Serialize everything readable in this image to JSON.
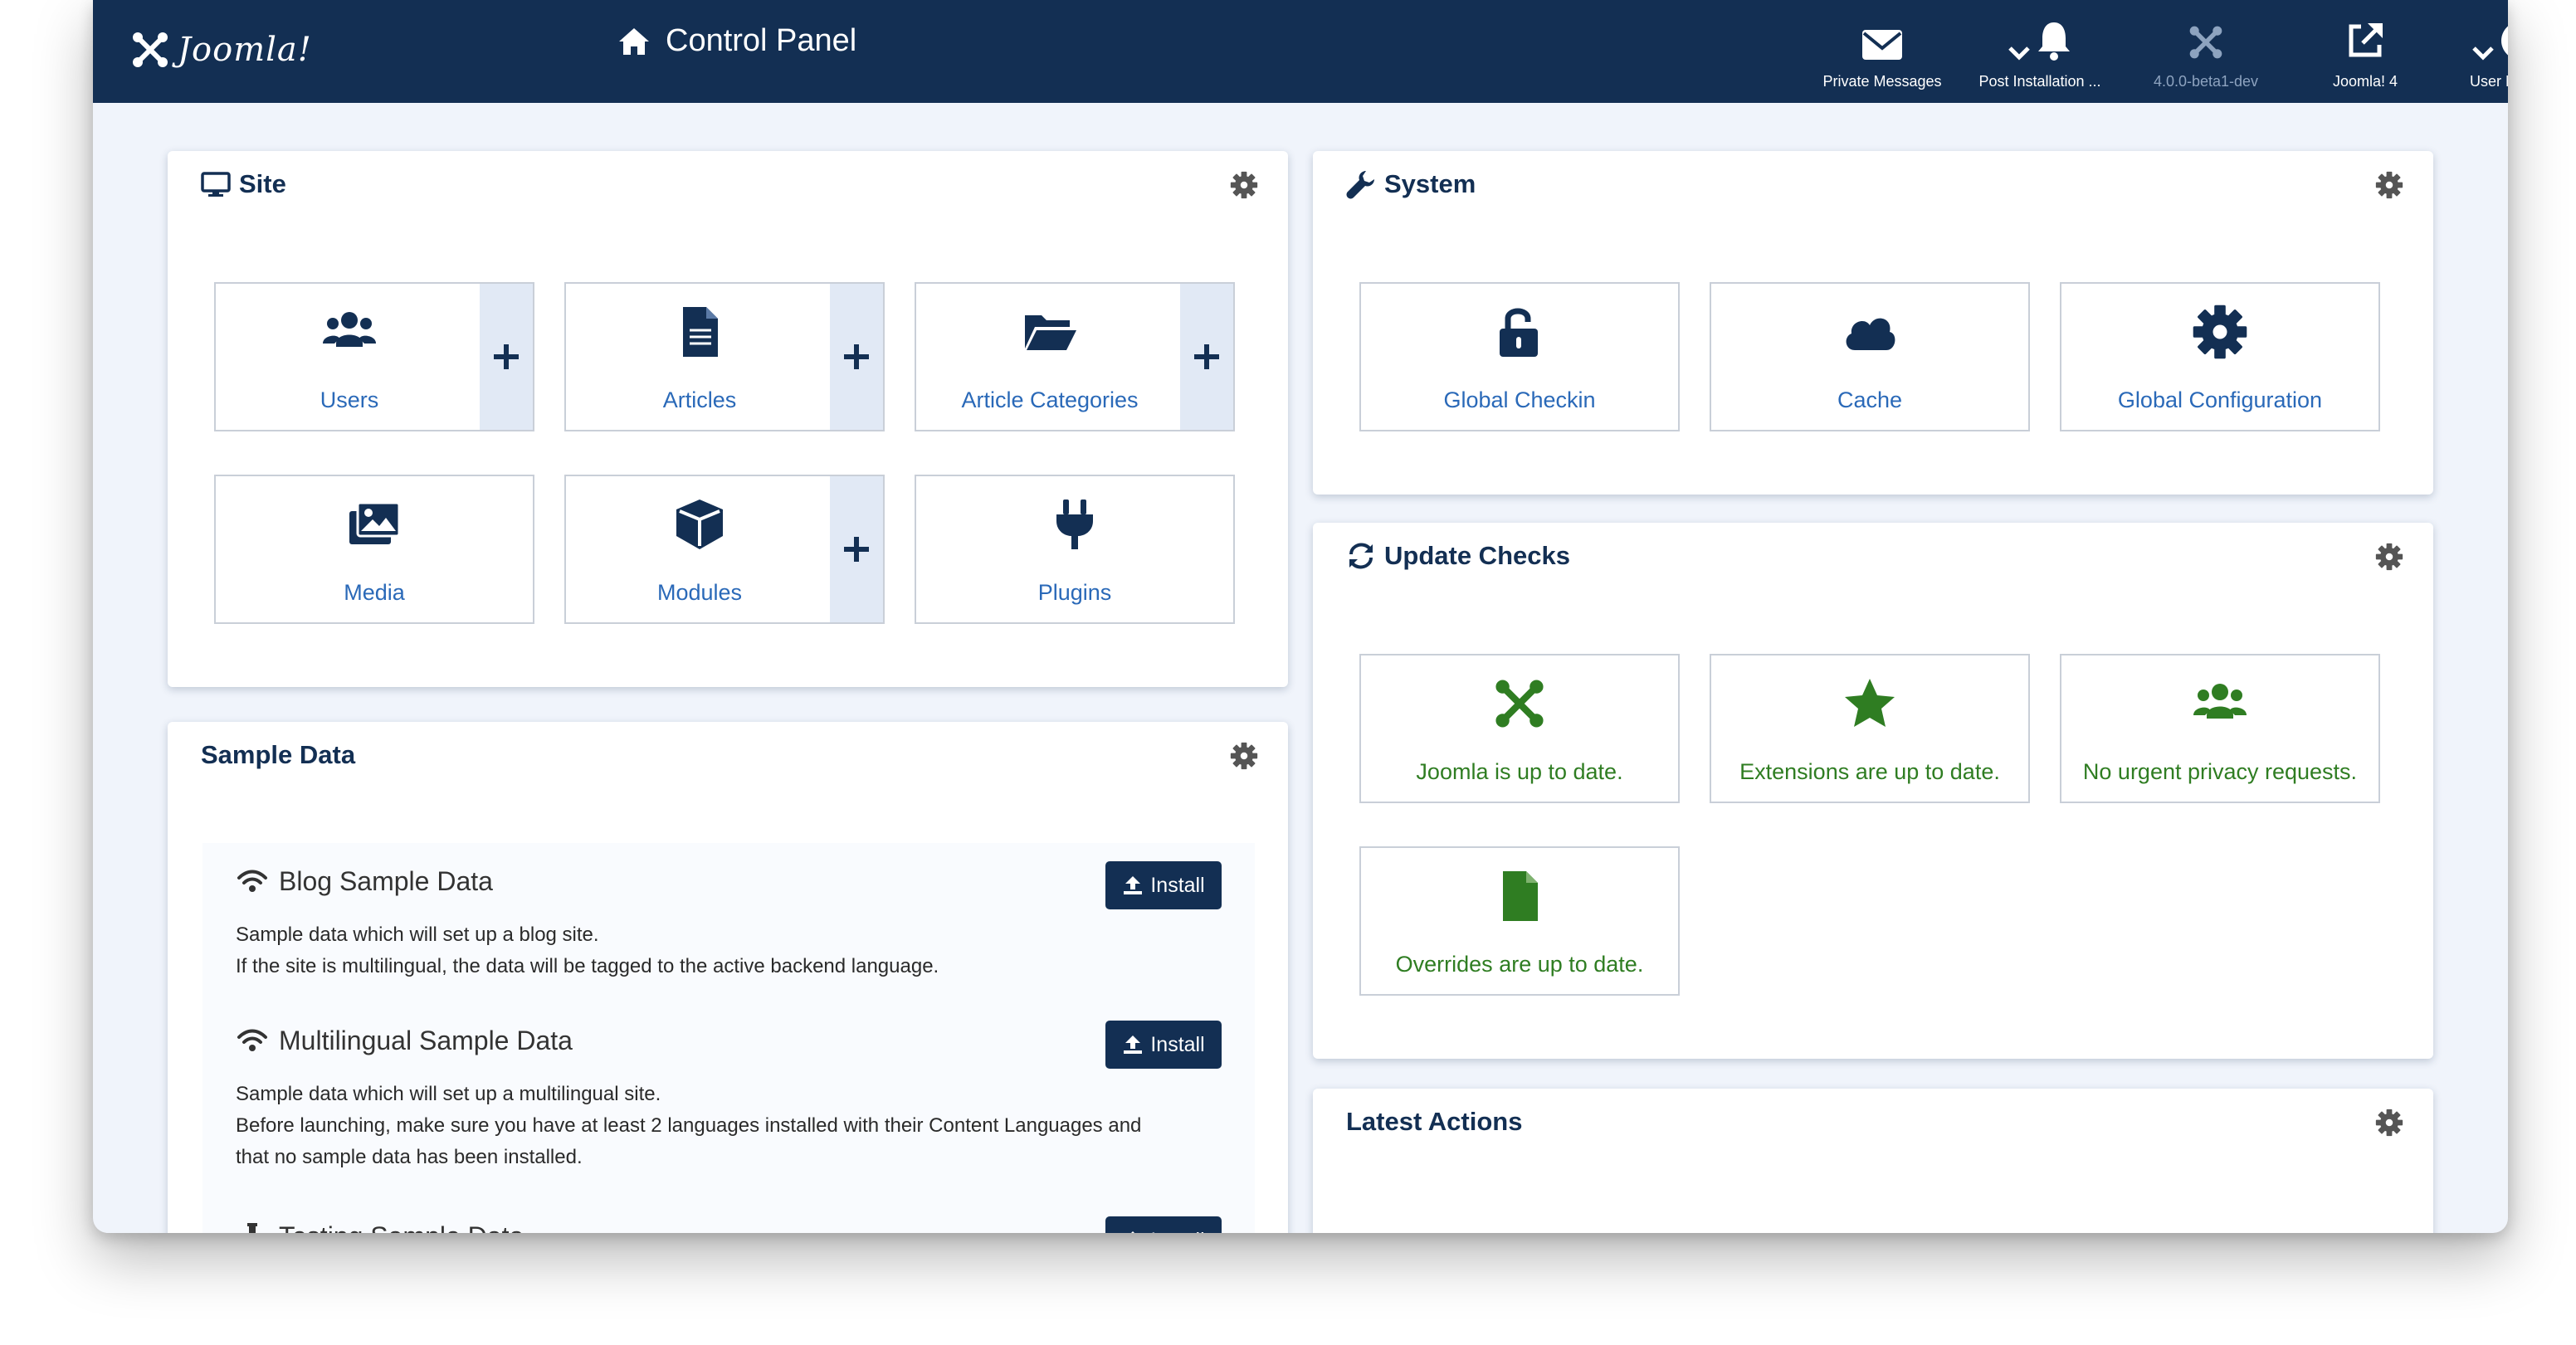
{
  "header": {
    "brand": "Joomla!",
    "title": "Control Panel",
    "items": [
      {
        "label": "Private Messages",
        "icon": "envelope-icon"
      },
      {
        "label": "Post Installation ...",
        "icon": "bell-icon"
      },
      {
        "label": "4.0.0-beta1-dev",
        "icon": "joomla-icon"
      },
      {
        "label": "Joomla! 4",
        "icon": "external-link-icon"
      },
      {
        "label": "User Menu",
        "icon": "user-circle-icon"
      }
    ]
  },
  "site": {
    "title": "Site",
    "tiles": [
      {
        "label": "Users",
        "icon": "users-icon",
        "add": true
      },
      {
        "label": "Articles",
        "icon": "file-icon",
        "add": true
      },
      {
        "label": "Article Categories",
        "icon": "folder-open-icon",
        "add": true
      },
      {
        "label": "Media",
        "icon": "images-icon",
        "add": false
      },
      {
        "label": "Modules",
        "icon": "cube-icon",
        "add": true
      },
      {
        "label": "Plugins",
        "icon": "plug-icon",
        "add": false
      }
    ]
  },
  "system": {
    "title": "System",
    "tiles": [
      {
        "label": "Global Checkin",
        "icon": "unlock-icon"
      },
      {
        "label": "Cache",
        "icon": "cloud-icon"
      },
      {
        "label": "Global Configuration",
        "icon": "cog-icon"
      }
    ]
  },
  "updates": {
    "title": "Update Checks",
    "tiles": [
      {
        "label": "Joomla is up to date.",
        "icon": "joomla-icon"
      },
      {
        "label": "Extensions are up to date.",
        "icon": "star-icon"
      },
      {
        "label": "No urgent privacy requests.",
        "icon": "users-icon"
      },
      {
        "label": "Overrides are up to date.",
        "icon": "file-icon"
      }
    ]
  },
  "sample_data": {
    "title": "Sample Data",
    "install_label": "Install",
    "items": [
      {
        "title": "Blog Sample Data",
        "lines": [
          "Sample data which will set up a blog site.",
          "If the site is multilingual, the data will be tagged to the active backend language."
        ]
      },
      {
        "title": "Multilingual Sample Data",
        "lines": [
          "Sample data which will set up a multilingual site.",
          "Before launching, make sure you have at least 2 languages installed with their Content Languages and",
          "that no sample data has been installed."
        ]
      },
      {
        "title": "Testing Sample Data",
        "lines": []
      }
    ]
  },
  "latest_actions": {
    "title": "Latest Actions"
  },
  "colors": {
    "navy": "#132f53",
    "link": "#2a69b8",
    "green": "#2f7d22",
    "plus_bg": "#e1e9f5"
  }
}
